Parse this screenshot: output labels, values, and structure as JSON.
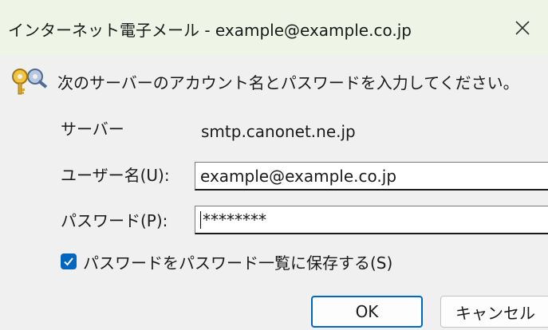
{
  "window": {
    "title": "インターネット電子メール - example@example.co.jp",
    "close_icon": "close-icon",
    "accent": "#0067c0",
    "titlebar_bg": "#eef5e6"
  },
  "prompt": {
    "icon": "keys-icon",
    "text": "次のサーバーのアカウント名とパスワードを入力してください。"
  },
  "form": {
    "server_label": "サーバー",
    "server_value": "smtp.canonet.ne.jp",
    "username_label": "ユーザー名(U):",
    "username_value": "example@example.co.jp",
    "password_label": "パスワード(P):",
    "password_value": "********"
  },
  "save_password": {
    "checked": true,
    "label": "パスワードをパスワード一覧に保存する(S)"
  },
  "buttons": {
    "ok": "OK",
    "cancel": "キャンセル"
  }
}
